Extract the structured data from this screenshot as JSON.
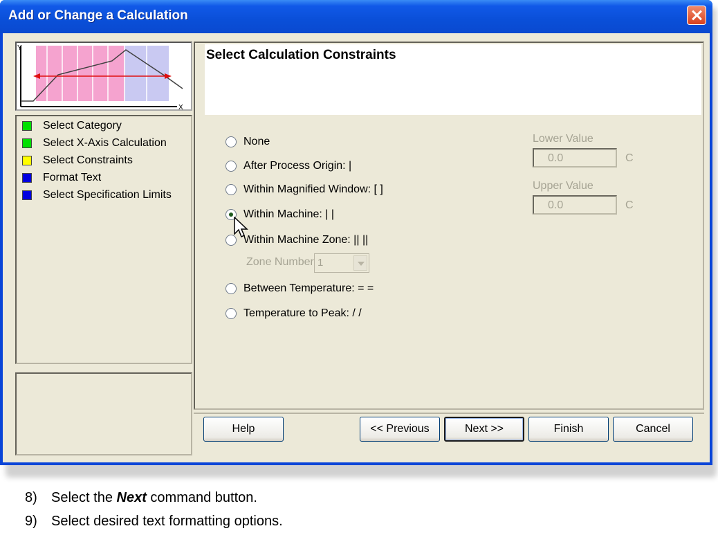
{
  "window": {
    "title": "Add or Change a Calculation"
  },
  "preview": {
    "y_label": "Y",
    "x_label": "X"
  },
  "steps": [
    {
      "label": "Select Category",
      "color": "#00e000"
    },
    {
      "label": "Select X-Axis Calculation",
      "color": "#00e000"
    },
    {
      "label": "Select Constraints",
      "color": "#ffff00"
    },
    {
      "label": "Format Text",
      "color": "#0000e0"
    },
    {
      "label": "Select Specification Limits",
      "color": "#0000e0"
    }
  ],
  "main": {
    "header_title": "Select Calculation Constraints",
    "options": [
      {
        "label": "None",
        "checked": false
      },
      {
        "label": "After Process Origin: |",
        "checked": false
      },
      {
        "label": "Within Magnified Window: [  ]",
        "checked": false
      },
      {
        "label": "Within Machine: |  |",
        "checked": true
      },
      {
        "label": "Within Machine Zone: ||  ||",
        "checked": false
      },
      {
        "label": "Between Temperature: =  =",
        "checked": false
      },
      {
        "label": "Temperature to Peak: /  /",
        "checked": false
      }
    ],
    "zone_number_label": "Zone Number",
    "zone_number_value": "1",
    "lower_value_label": "Lower Value",
    "lower_value": "0.0",
    "upper_value_label": "Upper Value",
    "upper_value": "0.0",
    "unit": "C"
  },
  "buttons": {
    "help": "Help",
    "previous": "<< Previous",
    "next": "Next >>",
    "finish": "Finish",
    "cancel": "Cancel"
  },
  "notes": [
    {
      "number": "8)",
      "text_before": "Select the ",
      "emphasis": "Next",
      "text_after": " command button."
    },
    {
      "number": "9)",
      "text": "Select desired text formatting options."
    }
  ]
}
